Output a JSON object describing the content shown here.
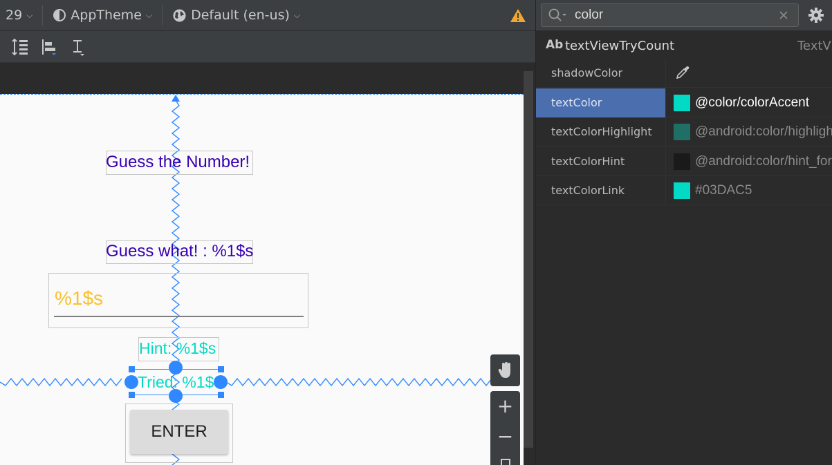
{
  "toolbar": {
    "api_level": "29",
    "theme": "AppTheme",
    "locale": "Default (en-us)"
  },
  "canvas": {
    "title_text": "Guess the Number!",
    "guess_what_text": "Guess what! : %1$s",
    "edit_text_value": "%1$s",
    "hint_text": "Hint: %1$s",
    "tried_text": "Tried: %1$",
    "enter_button": "ENTER",
    "zoom_in": "+",
    "zoom_out": "−"
  },
  "panel": {
    "search": {
      "value": "color"
    },
    "component": {
      "ab_label": "Ab",
      "name": "textViewTryCount",
      "type": "TextView"
    },
    "attributes": [
      {
        "name": "shadowColor",
        "value": "",
        "swatch": null,
        "value_color": "#bbbbbb"
      },
      {
        "name": "textColor",
        "value": "@color/colorAccent",
        "swatch": "#03dac5",
        "value_color": "#ffffff"
      },
      {
        "name": "textColorHighlight",
        "value": "@android:color/highlight",
        "swatch": "#1f6f66",
        "value_color": "#8a8a8a"
      },
      {
        "name": "textColorHint",
        "value": "@android:color/hint_foreground",
        "swatch": "#1a1a1a",
        "value_color": "#8a8a8a"
      },
      {
        "name": "textColorLink",
        "value": "#03DAC5",
        "swatch": "#03dac5",
        "value_color": "#8a8a8a"
      }
    ]
  },
  "colors": {
    "accent": "#03dac5",
    "primary_text": "#3700b3",
    "edit_text": "#fbc02d",
    "selection_blue": "#2f88ff",
    "warning": "#f0a732"
  }
}
